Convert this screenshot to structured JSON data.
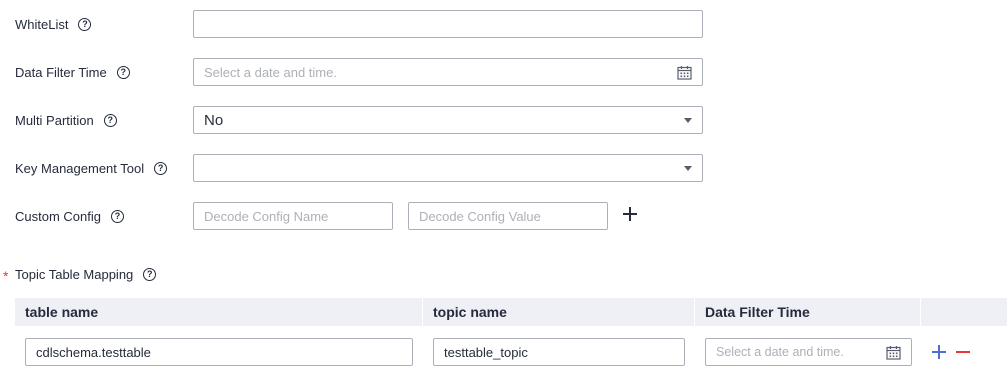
{
  "form": {
    "whitelist": {
      "label": "WhiteList",
      "value": ""
    },
    "data_filter_time": {
      "label": "Data Filter Time",
      "placeholder": "Select a date and time."
    },
    "multi_partition": {
      "label": "Multi Partition",
      "value": "No"
    },
    "key_management_tool": {
      "label": "Key Management Tool",
      "value": ""
    },
    "custom_config": {
      "label": "Custom Config",
      "name_placeholder": "Decode Config Name",
      "value_placeholder": "Decode Config Value"
    },
    "topic_table_mapping": {
      "label": "Topic Table Mapping",
      "required_mark": "*"
    }
  },
  "help_glyph": "?",
  "table": {
    "columns": [
      "table name",
      "topic name",
      "Data Filter Time",
      ""
    ],
    "rows": [
      {
        "table_name": "cdlschema.testtable",
        "topic_name": "testtable_topic",
        "filter_placeholder": "Select a date and time."
      }
    ]
  },
  "colors": {
    "add": "#526ecc",
    "remove": "#e53935",
    "border": "#adb0b8",
    "header_bg": "#eef0f5"
  },
  "icons": [
    "help-icon",
    "calendar-icon",
    "chevron-down-icon",
    "plus-icon",
    "minus-icon"
  ]
}
